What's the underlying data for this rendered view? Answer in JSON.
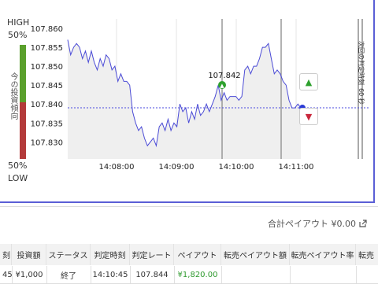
{
  "gauge": {
    "high_label": "HIGH",
    "high_pct": "50%",
    "low_pct": "50%",
    "low_label": "LOW",
    "vertical_text": "今の投資傾向",
    "up_color": "#5aa02c",
    "down_color": "#b33a3a"
  },
  "chart_data": {
    "type": "line",
    "y_ticks": [
      "107.860",
      "107.855",
      "107.850",
      "107.845",
      "107.840",
      "107.835",
      "107.830"
    ],
    "x_ticks": [
      "14:08:00",
      "14:09:00",
      "14:10:00",
      "14:11:00"
    ],
    "ylim": [
      107.8255,
      107.8625
    ],
    "entry_price_label": "107.842",
    "current_price": 107.839,
    "series": [
      {
        "values": [
          [
            0,
            107.857
          ],
          [
            1,
            107.853
          ],
          [
            2,
            107.855
          ],
          [
            3,
            107.856
          ],
          [
            4,
            107.855
          ],
          [
            5,
            107.852
          ],
          [
            6,
            107.854
          ],
          [
            7,
            107.851
          ],
          [
            8,
            107.854
          ],
          [
            9,
            107.851
          ],
          [
            10,
            107.849
          ],
          [
            11,
            107.852
          ],
          [
            12,
            107.85
          ],
          [
            13,
            107.853
          ],
          [
            14,
            107.852
          ],
          [
            15,
            107.849
          ],
          [
            16,
            107.85
          ],
          [
            17,
            107.846
          ],
          [
            18,
            107.848
          ],
          [
            19,
            107.846
          ],
          [
            20,
            107.846
          ],
          [
            21,
            107.845
          ],
          [
            22,
            107.838
          ],
          [
            23,
            107.835
          ],
          [
            24,
            107.833
          ],
          [
            25,
            107.834
          ],
          [
            26,
            107.831
          ],
          [
            27,
            107.829
          ],
          [
            28,
            107.83
          ],
          [
            29,
            107.831
          ],
          [
            30,
            107.829
          ],
          [
            31,
            107.834
          ],
          [
            32,
            107.835
          ],
          [
            33,
            107.833
          ],
          [
            34,
            107.836
          ],
          [
            35,
            107.833
          ],
          [
            36,
            107.835
          ],
          [
            37,
            107.834
          ],
          [
            38,
            107.84
          ],
          [
            39,
            107.838
          ],
          [
            40,
            107.839
          ],
          [
            41,
            107.835
          ],
          [
            42,
            107.838
          ],
          [
            43,
            107.836
          ],
          [
            44,
            107.84
          ],
          [
            45,
            107.837
          ],
          [
            46,
            107.838
          ],
          [
            47,
            107.84
          ],
          [
            48,
            107.838
          ],
          [
            49,
            107.84
          ],
          [
            50,
            107.842
          ],
          [
            51,
            107.845
          ],
          [
            52,
            107.841
          ],
          [
            53,
            107.843
          ],
          [
            54,
            107.841
          ],
          [
            55,
            107.842
          ],
          [
            56,
            107.842
          ],
          [
            57,
            107.842
          ],
          [
            58,
            107.841
          ],
          [
            59,
            107.842
          ],
          [
            60,
            107.849
          ],
          [
            61,
            107.85
          ],
          [
            62,
            107.848
          ],
          [
            63,
            107.85
          ],
          [
            64,
            107.85
          ],
          [
            65,
            107.852
          ],
          [
            66,
            107.855
          ],
          [
            67,
            107.855
          ],
          [
            68,
            107.856
          ],
          [
            69,
            107.852
          ],
          [
            70,
            107.848
          ],
          [
            71,
            107.849
          ],
          [
            72,
            107.848
          ],
          [
            73,
            107.846
          ],
          [
            74,
            107.845
          ],
          [
            75,
            107.841
          ],
          [
            76,
            107.839
          ],
          [
            77,
            107.839
          ],
          [
            78,
            107.84
          ],
          [
            79,
            107.839
          ]
        ]
      }
    ]
  },
  "markers": {
    "countdown_label": "次回の判定時刻",
    "countdown_value": "60 秒"
  },
  "trade_buttons": {
    "up_color": "#2ea12e",
    "down_color": "#c9273c"
  },
  "summary": {
    "label": "合計ペイアウト ¥0.00",
    "icon": "share-icon"
  },
  "table": {
    "headers": [
      "刻",
      "投資額",
      "ステータス",
      "判定時刻",
      "判定レート",
      "ペイアウト",
      "転売ペイアウト額",
      "転売ペイアウト率",
      "転売"
    ],
    "row": [
      "45",
      "¥1,000",
      "終了",
      "14:10:45",
      "107.844",
      "¥1,820.00",
      "",
      "",
      ""
    ],
    "payout_color": "#2e9a2e"
  }
}
